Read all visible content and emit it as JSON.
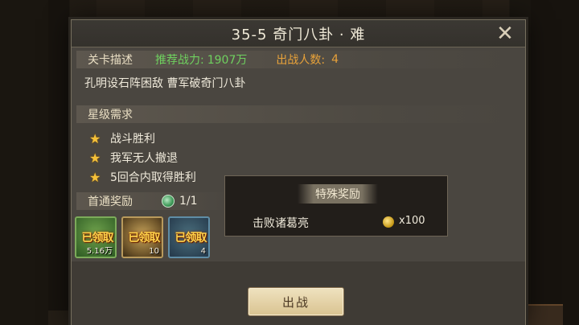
{
  "dialog": {
    "title": "35-5 奇门八卦 · 难",
    "close_icon": "close-x-icon"
  },
  "info_bar": {
    "label": "关卡描述",
    "power_label": "推荐战力:",
    "power_value": "1907万",
    "count_label": "出战人数:",
    "count_value": "4"
  },
  "description": "孔明设石阵困敌 曹军破奇门八卦",
  "stars": {
    "label": "星级需求",
    "items": [
      "战斗胜利",
      "我军无人撤退",
      "5回合内取得胜利"
    ]
  },
  "first_reward": {
    "label": "首通奖励",
    "count": "1/1",
    "items": [
      {
        "claimed_label": "已领取",
        "qty": "5.16万"
      },
      {
        "claimed_label": "已领取",
        "qty": "10"
      },
      {
        "claimed_label": "已领取",
        "qty": "4"
      }
    ]
  },
  "special_reward": {
    "title": "特殊奖励",
    "condition": "击败诸葛亮",
    "qty": "x100"
  },
  "fight_button": "出战",
  "colors": {
    "accent_green": "#6fd15f",
    "accent_orange": "#e8a23a",
    "star_gold": "#f5c13a"
  }
}
